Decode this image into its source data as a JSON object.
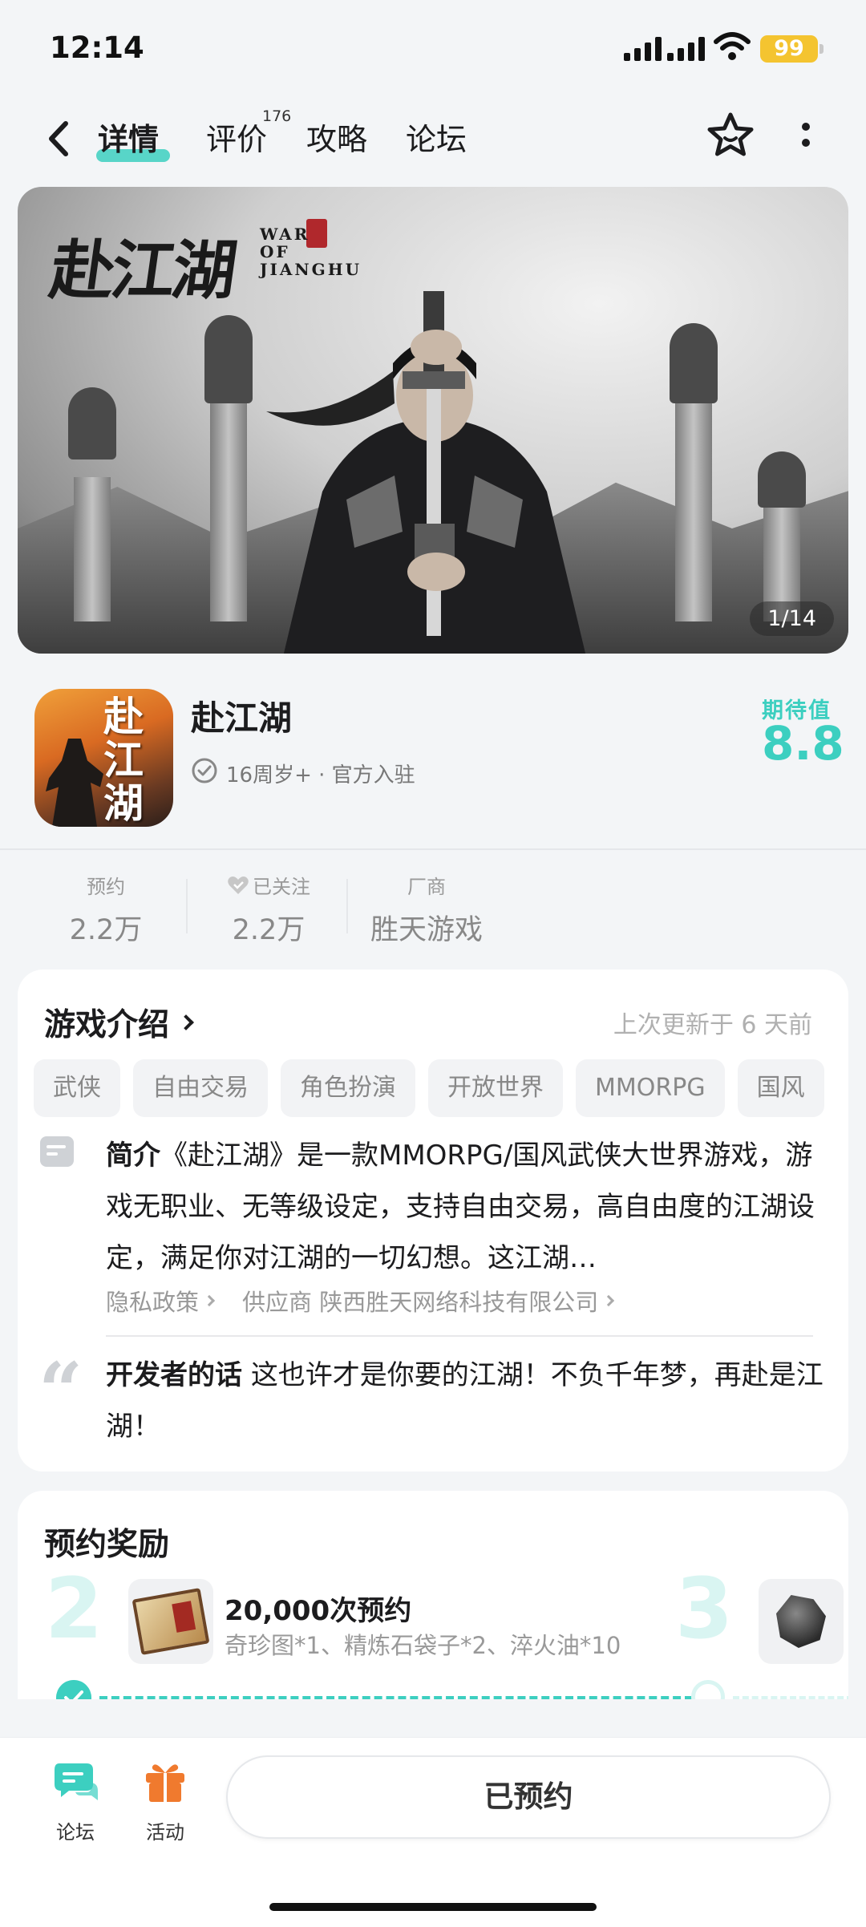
{
  "status_bar": {
    "time": "12:14",
    "battery": "99"
  },
  "nav": {
    "tabs": [
      {
        "label": "详情"
      },
      {
        "label": "评价"
      },
      {
        "label": "攻略"
      },
      {
        "label": "论坛"
      }
    ],
    "review_count": "176"
  },
  "banner": {
    "logo_cn": "赴江湖",
    "logo_en_1": "WAR",
    "logo_en_2": "OF",
    "logo_en_3": "JIANGHU",
    "counter": "1/14"
  },
  "game": {
    "icon_text": "赴江湖",
    "name": "赴江湖",
    "age_info": "16周岁+ · 官方入驻",
    "expect_label": "期待值",
    "expect_value": "8.8"
  },
  "stats": [
    {
      "label": "预约",
      "value": "2.2万"
    },
    {
      "label": "已关注",
      "value": "2.2万"
    },
    {
      "label": "厂商",
      "value": "胜天游戏"
    }
  ],
  "intro": {
    "title": "游戏介绍",
    "updated": "上次更新于 6 天前",
    "tags": [
      "武侠",
      "自由交易",
      "角色扮演",
      "开放世界",
      "MMORPG",
      "国风"
    ],
    "summary_label": "简介",
    "summary": "《赴江湖》是一款MMORPG/国风武侠大世界游戏，游戏无职业、无等级设定，支持自由交易，高自由度的江湖设定，满足你对江湖的一切幻想。这江湖…",
    "privacy_link": "隐私政策",
    "supplier_link": "供应商 陕西胜天网络科技有限公司",
    "dev_label": "开发者的话",
    "dev_words": "这也许才是你要的江湖！不负千年梦，再赴是江湖！"
  },
  "rewards": {
    "title": "预约奖励",
    "milestones": [
      {
        "number": "2",
        "name": "20,000次预约",
        "desc": "奇珍图*1、精炼石袋子*2、淬火油*10",
        "reached": true
      },
      {
        "number": "3",
        "reached": false
      }
    ]
  },
  "bottom_bar": {
    "forum_label": "论坛",
    "activity_label": "活动",
    "reserved_label": "已预约"
  },
  "colors": {
    "accent": "#3ccfc0",
    "activity": "#f07a2e",
    "forum": "#3ccfc0"
  }
}
